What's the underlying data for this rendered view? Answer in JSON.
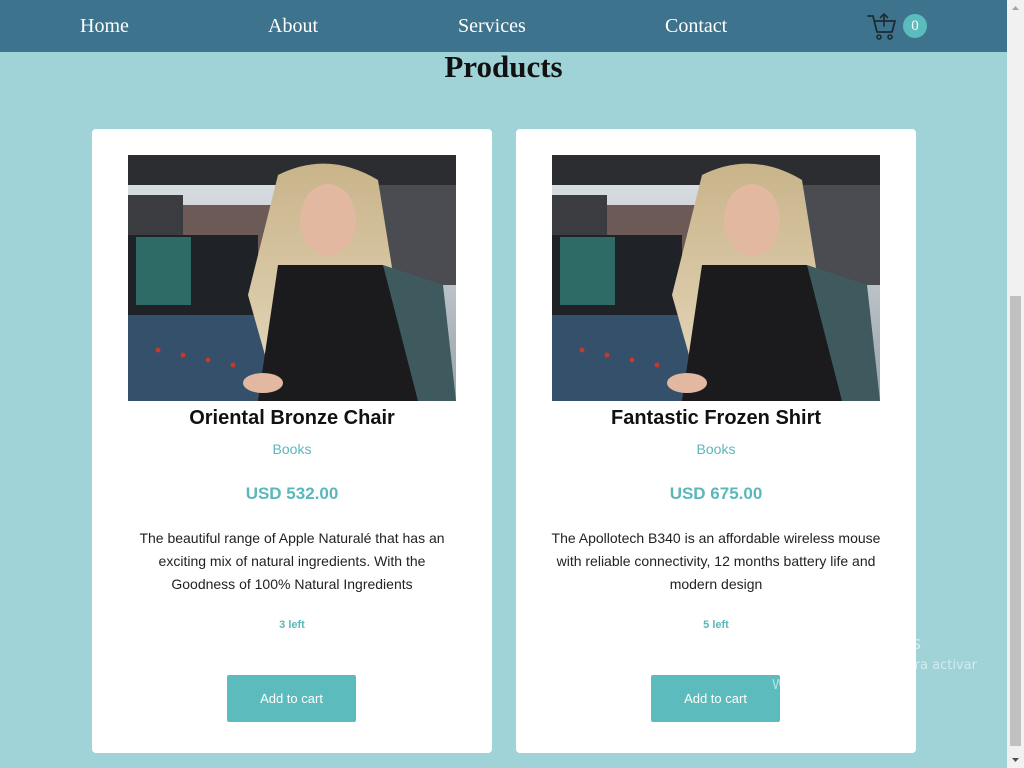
{
  "nav": {
    "links": [
      "Home",
      "About",
      "Services",
      "Contact"
    ],
    "cart_count": "0"
  },
  "page": {
    "title": "Products"
  },
  "products": [
    {
      "name": "Oriental Bronze Chair",
      "category": "Books",
      "price": "USD 532.00",
      "description": "The beautiful range of Apple Naturalé that has an exciting mix of natural ingredients. With the Goodness of 100% Natural Ingredients",
      "stock": "3 left",
      "button_label": "Add to cart",
      "image_icon": "product-photo"
    },
    {
      "name": "Fantastic Frozen Shirt",
      "category": "Books",
      "price": "USD 675.00",
      "description": "The Apollotech B340 is an affordable wireless mouse with reliable connectivity, 12 months battery life and modern design",
      "stock": "5 left",
      "button_label": "Add to cart",
      "image_icon": "product-photo"
    }
  ],
  "watermark": {
    "title": "Activar Windows",
    "subtitle": "Ve a Configuración para activar Windows."
  },
  "colors": {
    "navbar": "#3e738d",
    "page_background": "#9fd3d7",
    "accent": "#5cbcbd",
    "card": "#ffffff"
  }
}
